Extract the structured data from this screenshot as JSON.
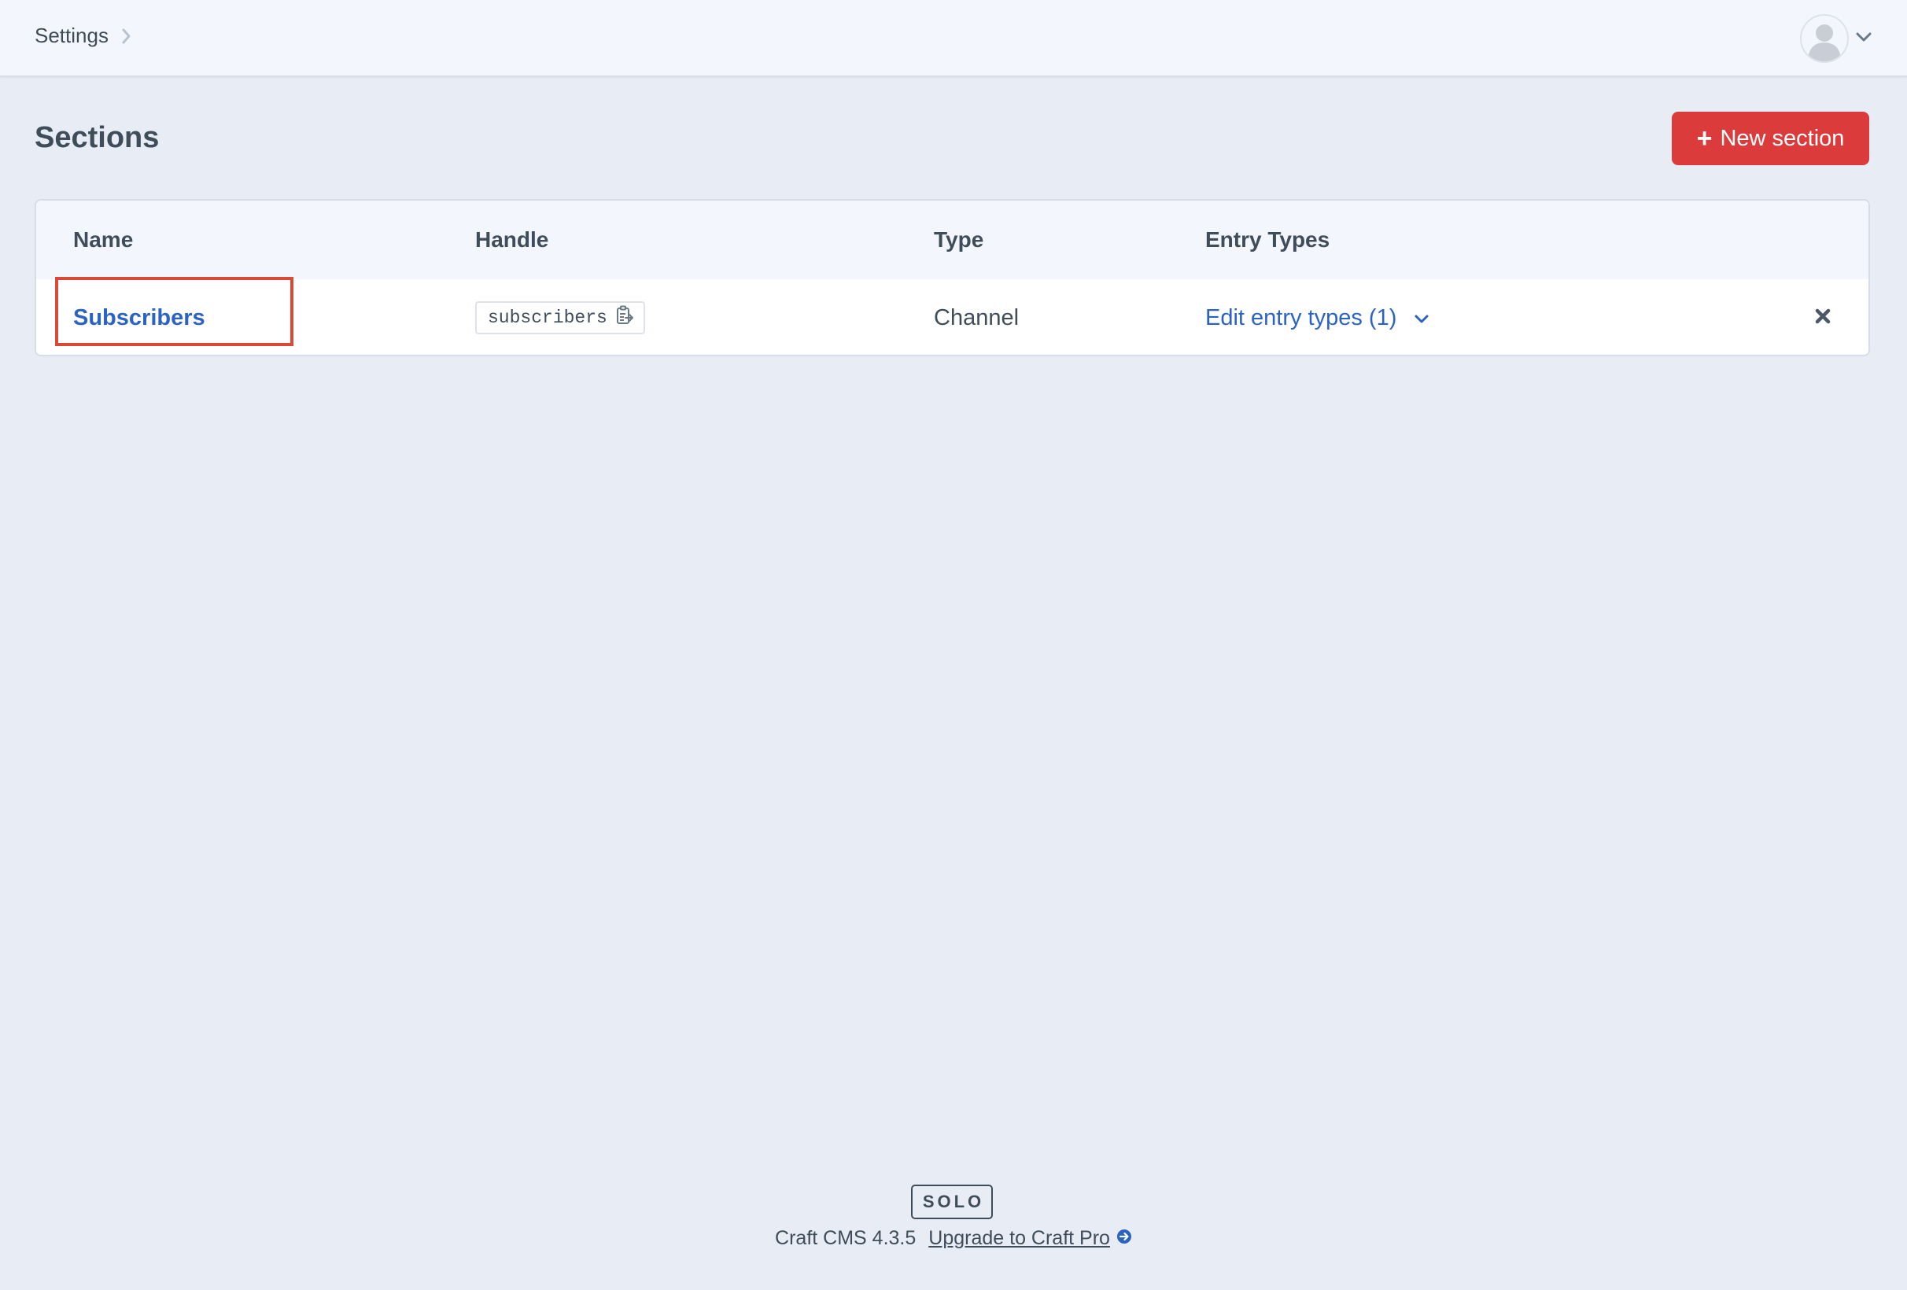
{
  "header": {
    "breadcrumb": {
      "label": "Settings"
    },
    "user_menu": {
      "avatar": "user-avatar-placeholder",
      "caret": "chevron-down-icon"
    }
  },
  "page": {
    "title": "Sections",
    "new_button": {
      "plus": "+",
      "label": "New section"
    }
  },
  "table": {
    "columns": [
      "Name",
      "Handle",
      "Type",
      "Entry Types"
    ],
    "rows": [
      {
        "name": "Subscribers",
        "handle": "subscribers",
        "type": "Channel",
        "entry_types": "Edit entry types (1)"
      }
    ]
  },
  "footer": {
    "edition": "SOLO",
    "version": "Craft CMS 4.3.5",
    "upgrade": "Upgrade to Craft Pro"
  },
  "colors": {
    "accent_red": "#dc3b3b",
    "link_blue": "#2b63c4",
    "highlight": "#d94a36",
    "background": "#e8ecf5"
  }
}
